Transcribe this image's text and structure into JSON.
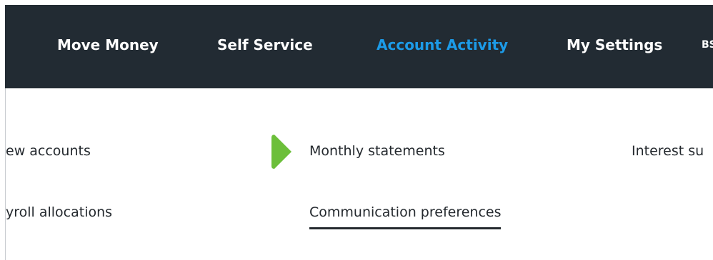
{
  "nav": {
    "items": [
      {
        "label": "Move Money"
      },
      {
        "label": "Self Service"
      },
      {
        "label": "Account Activity",
        "active": true
      },
      {
        "label": "My Settings"
      },
      {
        "label": "BS"
      }
    ]
  },
  "submenu": {
    "view_accounts": "ew accounts",
    "monthly_statements": "Monthly statements",
    "interest": "Interest su",
    "payroll_allocations": "yroll allocations",
    "communication_preferences": "Communication preferences",
    "marker_icon": "triangle-right-icon"
  },
  "colors": {
    "nav_bg": "#222b33",
    "nav_text": "#ffffff",
    "nav_active": "#1c9be8",
    "marker_green": "#6cbf3a",
    "link_text": "#24292e"
  }
}
